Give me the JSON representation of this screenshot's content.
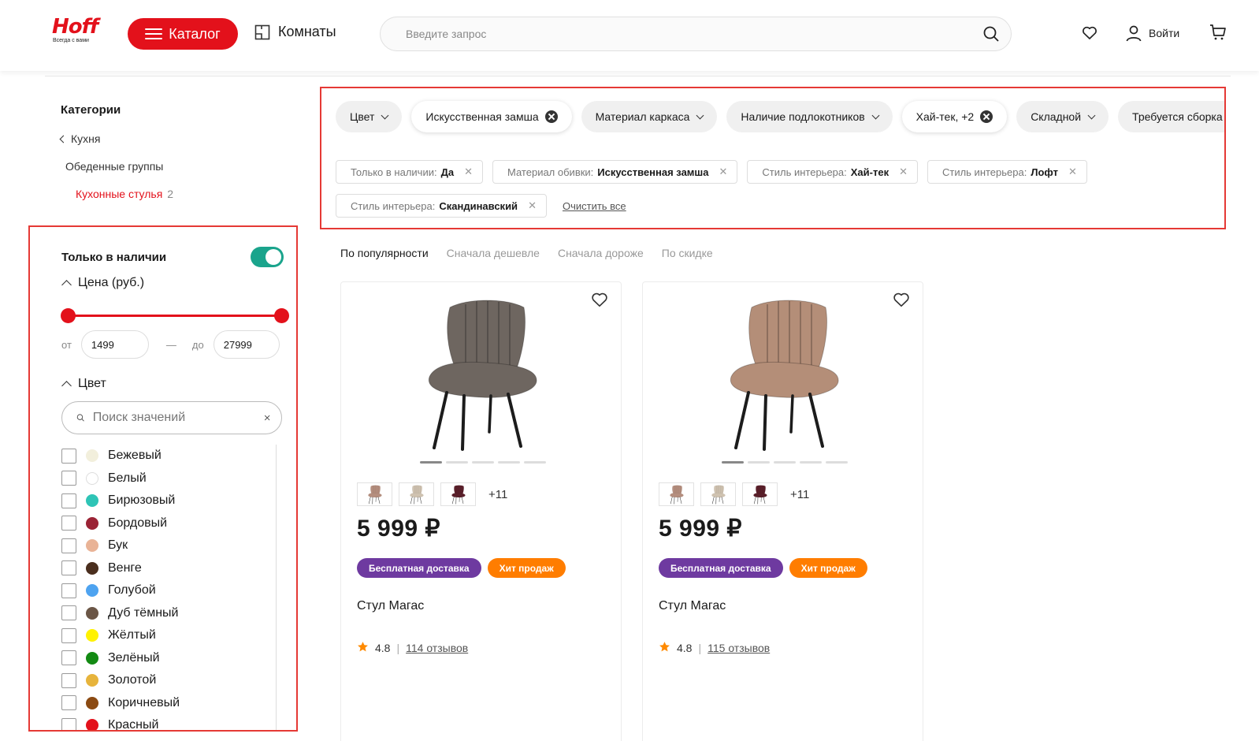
{
  "header": {
    "logo": "Hoff",
    "logo_tagline": "Всегда с вами",
    "catalog_label": "Каталог",
    "rooms_label": "Комнаты",
    "search_placeholder": "Введите запрос",
    "login_label": "Войти",
    "icons": [
      "search-icon",
      "heart-icon",
      "user-icon",
      "cart-icon",
      "rooms-icon",
      "menu-icon"
    ]
  },
  "categories": {
    "title": "Категории",
    "back": "Кухня",
    "group": "Обеденные группы",
    "current": "Кухонные стулья",
    "current_count": "2"
  },
  "filters": {
    "in_stock_label": "Только в наличии",
    "in_stock_on": true,
    "price": {
      "title": "Цена (руб.)",
      "from_label": "от",
      "to_label": "до",
      "dash": "—",
      "min": "1499",
      "max": "27999"
    },
    "color": {
      "title": "Цвет",
      "search_placeholder": "Поиск значений",
      "items": [
        {
          "label": "Бежевый",
          "color": "#f2efdc"
        },
        {
          "label": "Белый",
          "color": "#ffffff"
        },
        {
          "label": "Бирюзовый",
          "color": "#2ec4b6"
        },
        {
          "label": "Бордовый",
          "color": "#9b2335"
        },
        {
          "label": "Бук",
          "color": "#e9b396"
        },
        {
          "label": "Венге",
          "color": "#4a2e1e"
        },
        {
          "label": "Голубой",
          "color": "#4ea3f0"
        },
        {
          "label": "Дуб тёмный",
          "color": "#6b5646"
        },
        {
          "label": "Жёлтый",
          "color": "#fff200"
        },
        {
          "label": "Зелёный",
          "color": "#138a13"
        },
        {
          "label": "Золотой",
          "color": "#e7b43c"
        },
        {
          "label": "Коричневый",
          "color": "#8b4a12"
        },
        {
          "label": "Красный",
          "color": "#e3111b"
        }
      ]
    }
  },
  "chips": [
    {
      "label": "Цвет",
      "type": "dropdown"
    },
    {
      "label": "Искусственная замша",
      "type": "active"
    },
    {
      "label": "Материал каркаса",
      "type": "dropdown"
    },
    {
      "label": "Наличие подлокотников",
      "type": "dropdown"
    },
    {
      "label": "Хай-тек, +2",
      "type": "active"
    },
    {
      "label": "Складной",
      "type": "dropdown"
    },
    {
      "label": "Требуется сборка",
      "type": "dropdown"
    }
  ],
  "applied": [
    {
      "name": "Только в наличии:",
      "value": "Да"
    },
    {
      "name": "Материал обивки:",
      "value": "Искусственная замша"
    },
    {
      "name": "Стиль интерьера:",
      "value": "Хай-тек"
    },
    {
      "name": "Стиль интерьера:",
      "value": "Лофт"
    },
    {
      "name": "Стиль интерьера:",
      "value": "Скандинавский"
    }
  ],
  "clear_all": "Очистить все",
  "sort": [
    "По популярности",
    "Сначала дешевле",
    "Сначала дороже",
    "По скидке"
  ],
  "sort_active": 0,
  "products": [
    {
      "price": "5 999 ₽",
      "name": "Стул Магас",
      "badge1": "Бесплатная доставка",
      "badge2": "Хит продаж",
      "rating": "4.8",
      "reviews": "114 отзывов",
      "more": "+11",
      "seat": "#6e6660",
      "thumbs": [
        "#b58e7e",
        "#cfc2b0",
        "#5a1f2a"
      ]
    },
    {
      "price": "5 999 ₽",
      "name": "Стул Магас",
      "badge1": "Бесплатная доставка",
      "badge2": "Хит продаж",
      "rating": "4.8",
      "reviews": "115 отзывов",
      "more": "+11",
      "seat": "#b48e78",
      "thumbs": [
        "#b58e7e",
        "#cfc2b0",
        "#5a1f2a"
      ]
    }
  ]
}
